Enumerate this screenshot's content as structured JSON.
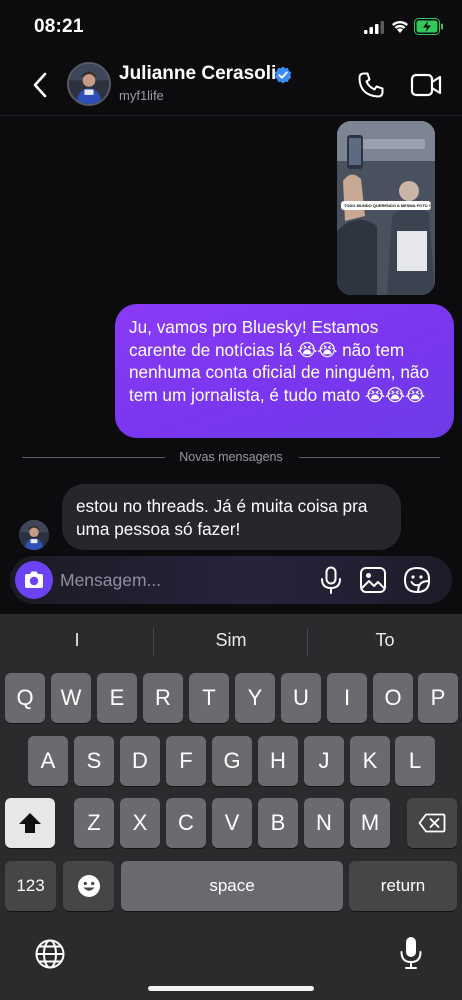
{
  "status_bar": {
    "time": "08:21"
  },
  "header": {
    "back_icon": "chevron-left-icon",
    "contact_name": "Julianne Cerasoli",
    "verified_icon": "verified-badge-icon",
    "handle": "myf1life",
    "call_icon": "phone-icon",
    "video_icon": "video-camera-icon"
  },
  "messages": {
    "photo": {
      "caption": "TODO MUNDO QUERENDO A MESMA FOTO 😂"
    },
    "outgoing": "Ju, vamos pro Bluesky! Estamos carente de notícias lá 😭😭 não tem nenhuma conta oficial de ninguém, não tem um jornalista, é tudo mato 😭😭😭",
    "divider_label": "Novas mensagens",
    "incoming": "estou no threads. Já é muita coisa pra uma pessoa só fazer!"
  },
  "composer": {
    "placeholder": "Mensagem...",
    "camera_icon": "camera-icon",
    "mic_icon": "microphone-icon",
    "gallery_icon": "image-gallery-icon",
    "sticker_icon": "sticker-icon"
  },
  "keyboard": {
    "suggestions": [
      "I",
      "Sim",
      "To"
    ],
    "row1": [
      "Q",
      "W",
      "E",
      "R",
      "T",
      "Y",
      "U",
      "I",
      "O",
      "P"
    ],
    "row2": [
      "A",
      "S",
      "D",
      "F",
      "G",
      "H",
      "J",
      "K",
      "L"
    ],
    "row3": [
      "Z",
      "X",
      "C",
      "V",
      "B",
      "N",
      "M"
    ],
    "numbers_label": "123",
    "space_label": "space",
    "return_label": "return",
    "shift_icon": "shift-icon",
    "delete_icon": "backspace-icon",
    "emoji_icon": "emoji-icon",
    "globe_icon": "globe-icon",
    "dictation_icon": "microphone-icon"
  },
  "colors": {
    "accent_purple": "#7a36ef",
    "camera_button": "#6b43f2",
    "verified_blue": "#3b8cf5",
    "battery_green": "#34c759"
  }
}
